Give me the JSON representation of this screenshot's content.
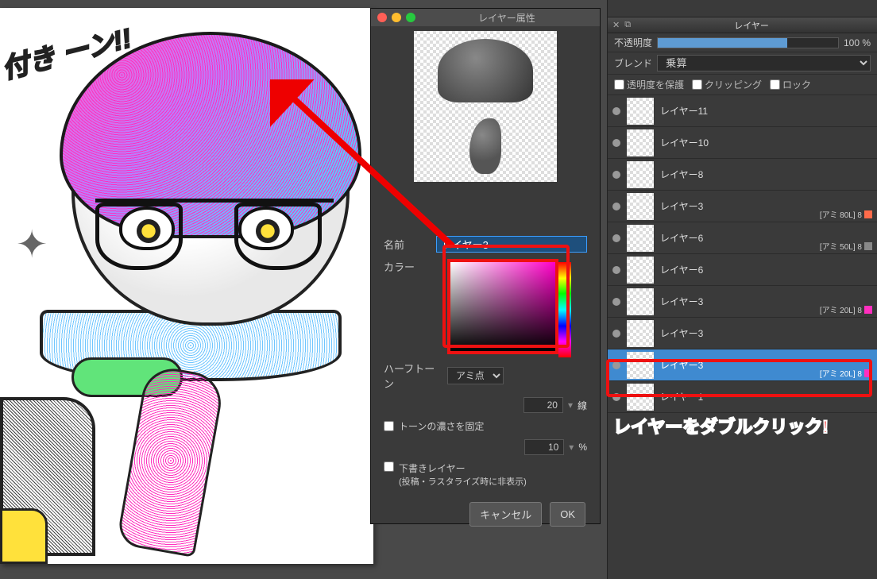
{
  "canvas": {
    "bubble_text": "付き\nーン!!"
  },
  "dialog": {
    "title": "レイヤー属性",
    "name_label": "名前",
    "name_value": "レイヤー3",
    "color_label": "カラー",
    "halftone_label": "ハーフトーン",
    "halftone_value": "アミ点",
    "lines_value": "20",
    "lines_unit": "線",
    "fix_density_label": "トーンの濃さを固定",
    "density_value": "10",
    "density_unit": "%",
    "draft_label": "下書きレイヤー",
    "draft_sub": "(投稿・ラスタライズ時に非表示)",
    "cancel": "キャンセル",
    "ok": "OK"
  },
  "panel": {
    "title": "レイヤー",
    "opacity_label": "不透明度",
    "opacity_value": "100 %",
    "opacity_pct": 72,
    "blend_label": "ブレンド",
    "blend_value": "乗算",
    "protect_alpha": "透明度を保護",
    "clipping": "クリッピング",
    "lock": "ロック",
    "layers": [
      {
        "name": "レイヤー11",
        "tag": "",
        "swatch": ""
      },
      {
        "name": "レイヤー10",
        "tag": "",
        "swatch": ""
      },
      {
        "name": "レイヤー8",
        "tag": "",
        "swatch": ""
      },
      {
        "name": "レイヤー3",
        "tag": "[アミ 80L] 8",
        "swatch": "#ff6b4a"
      },
      {
        "name": "レイヤー6",
        "tag": "[アミ 50L] 8",
        "swatch": "#888"
      },
      {
        "name": "レイヤー6",
        "tag": "",
        "swatch": ""
      },
      {
        "name": "レイヤー3",
        "tag": "[アミ 20L] 8",
        "swatch": "#ff2fbf"
      },
      {
        "name": "レイヤー3",
        "tag": "",
        "swatch": ""
      },
      {
        "name": "レイヤー3",
        "tag": "[アミ 20L] 8",
        "swatch": "#ff2fbf",
        "selected": true
      },
      {
        "name": "レイヤー1",
        "tag": "",
        "swatch": ""
      }
    ]
  },
  "annotation": {
    "callout": "レイヤーをダブルクリック!"
  }
}
